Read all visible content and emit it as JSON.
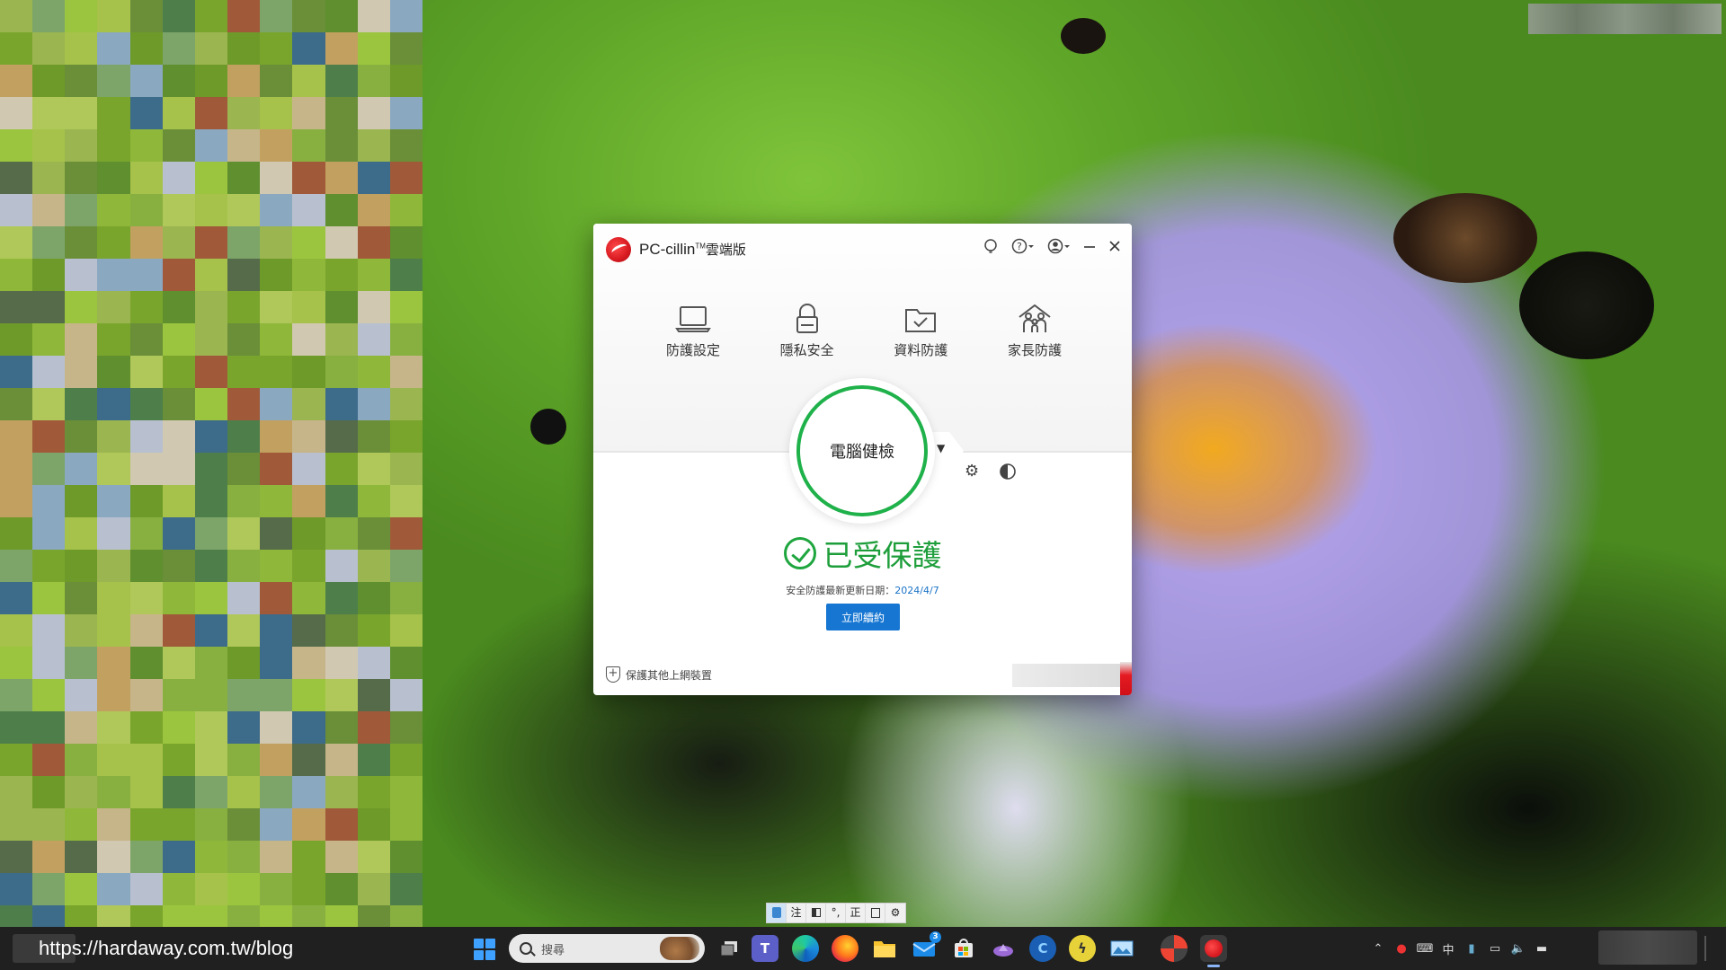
{
  "app": {
    "title_main": "PC-cillin",
    "title_tm": "TM",
    "title_suffix": "雲端版",
    "nav": [
      {
        "label": "防護設定",
        "icon": "laptop-icon"
      },
      {
        "label": "隱私安全",
        "icon": "lock-icon"
      },
      {
        "label": "資料防護",
        "icon": "folder-check-icon"
      },
      {
        "label": "家長防護",
        "icon": "family-icon"
      }
    ],
    "scan_label": "電腦健檢",
    "status_text": "已受保護",
    "update_prefix": "安全防護最新更新日期：",
    "update_date": "2024/4/7",
    "renew_label": "立即續約",
    "protect_others_label": "保護其他上網裝置",
    "colors": {
      "accent_green": "#1fb14a",
      "button_blue": "#1676d2",
      "brand_red": "#d71920"
    }
  },
  "ime": {
    "buttons": [
      "",
      "注",
      "",
      "°,",
      "正",
      "",
      "⚙"
    ]
  },
  "taskbar": {
    "watermark": "https://hardaway.com.tw/blog",
    "search_placeholder": "搜尋",
    "mail_badge": "3",
    "tray": {
      "ime_mode": "中"
    }
  }
}
